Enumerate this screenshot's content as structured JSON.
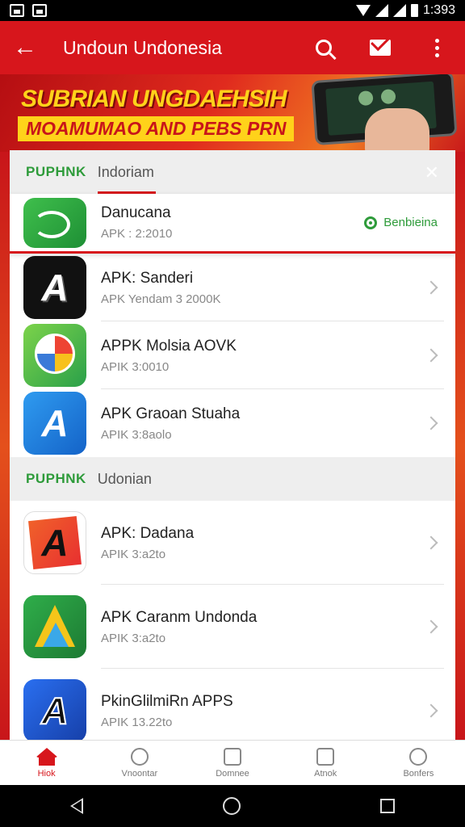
{
  "status_bar": {
    "time": "1:393"
  },
  "app_bar": {
    "title": "Undoun Undonesia"
  },
  "banner": {
    "headline": "SUBRIAN UNGDAEHSIH",
    "subline": "MOAMUMAO AND PEBS PRN"
  },
  "section1": {
    "brand": "PUPHNK",
    "tab": "Indoriam"
  },
  "featured": {
    "name": "Danucana",
    "sub": "APK : 2:2010",
    "badge": "Benbieina"
  },
  "apps1": [
    {
      "name": "APK: Sanderi",
      "sub": "APK Yendam 3 2000K"
    },
    {
      "name": "APPK Molsia AOVK",
      "sub": "APIK 3:0010"
    },
    {
      "name": "APK Graoan Stuaha",
      "sub": "APIK 3:8aolo"
    }
  ],
  "section2": {
    "brand": "PUPHNK",
    "tab": "Udonian"
  },
  "apps2": [
    {
      "name": "APK: Dadana",
      "sub": "APIK 3:a2to"
    },
    {
      "name": "APK Caranm Undonda",
      "sub": "APIK 3:a2to"
    },
    {
      "name": "PkinGlilmiRn APPS",
      "sub": "APIK 13.22to"
    }
  ],
  "bottom_nav": [
    {
      "label": "Hiok",
      "active": true
    },
    {
      "label": "Vnoontar"
    },
    {
      "label": "Domnee"
    },
    {
      "label": "Atnok"
    },
    {
      "label": "Bonfers"
    }
  ],
  "colors": {
    "primary": "#d7161c",
    "accent_green": "#2e9b3a",
    "banner_yellow": "#ffd21a"
  }
}
